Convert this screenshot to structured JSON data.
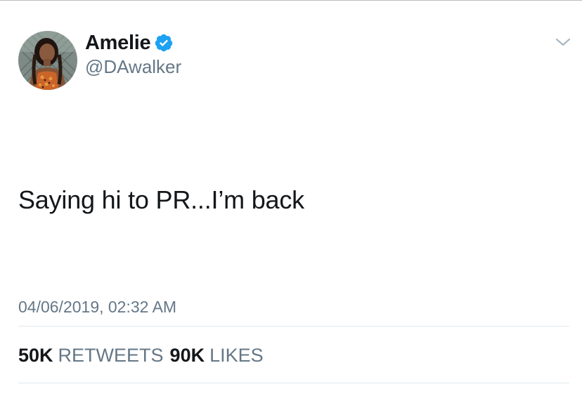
{
  "user": {
    "display_name": "Amelie",
    "handle": "@DAwalker",
    "verified": true
  },
  "tweet": {
    "text": "Saying hi to PR...I’m back",
    "timestamp": "04/06/2019, 02:32 AM"
  },
  "stats": {
    "retweets_count": "50K",
    "retweets_label": "RETWEETS",
    "likes_count": "90K",
    "likes_label": "LIKES"
  },
  "colors": {
    "verified_badge": "#1da1f2",
    "secondary_text": "#657786",
    "primary_text": "#14171a"
  },
  "icons": {
    "verified": "verified-badge-icon",
    "more": "chevron-down-icon"
  }
}
